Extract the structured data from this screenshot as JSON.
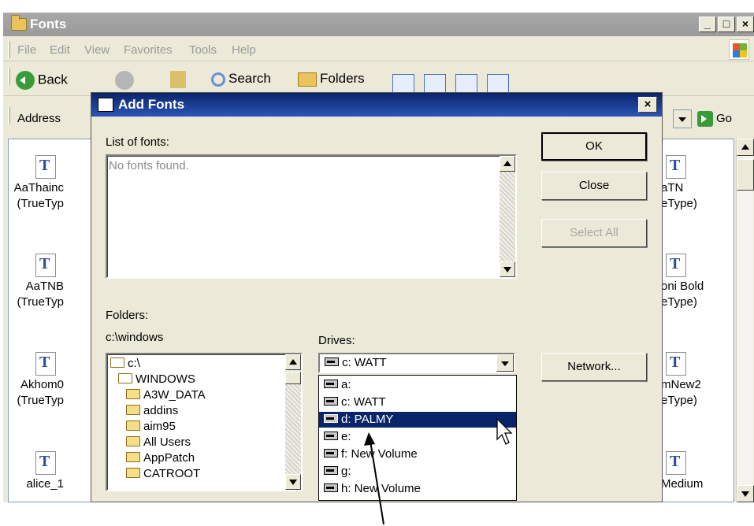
{
  "window": {
    "title": "Fonts",
    "minimize": "_",
    "maximize": "□",
    "close": "×"
  },
  "menu": [
    "File",
    "Edit",
    "View",
    "Favorites",
    "Tools",
    "Help"
  ],
  "toolbar": {
    "back": "Back",
    "search": "Search",
    "folders": "Folders"
  },
  "address": {
    "label": "Address",
    "go": "Go"
  },
  "font_items_left": [
    {
      "line1": "AaThainc",
      "line2": "(TrueTyp"
    },
    {
      "line1": "AaTNB",
      "line2": "(TrueTyp"
    },
    {
      "line1": "Akhom0",
      "line2": "(TrueTyp"
    },
    {
      "line1": "alice_1",
      "line2": ""
    }
  ],
  "font_items_right": [
    {
      "line1": "aTN",
      "line2": "eType)"
    },
    {
      "line1": "oni Bold",
      "line2": "eType)"
    },
    {
      "line1": "mNew2",
      "line2": "eType)"
    },
    {
      "line1": "Medium",
      "line2": ""
    }
  ],
  "dialog": {
    "title": "Add Fonts",
    "close": "×",
    "list_label": "List of fonts:",
    "list_empty": "No fonts found.",
    "ok": "OK",
    "close_btn": "Close",
    "select_all": "Select All",
    "folders_label": "Folders:",
    "current_path": "c:\\windows",
    "drives_label": "Drives:",
    "network": "Network...",
    "folder_tree": [
      "c:\\",
      "WINDOWS",
      "A3W_DATA",
      "addins",
      "aim95",
      "All Users",
      "AppPatch",
      "CATROOT"
    ],
    "drive_selected": "c: WATT",
    "drive_options": [
      "a:",
      "c: WATT",
      "d: PALMY",
      "e:",
      "f: New Volume",
      "g:",
      "h: New Volume"
    ],
    "highlighted_drive": "d: PALMY"
  }
}
